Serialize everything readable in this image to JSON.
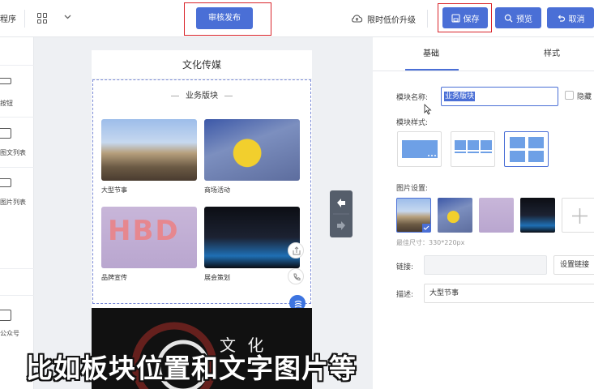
{
  "topbar": {
    "left_text": "程序",
    "publish_label": "审核发布",
    "upgrade_label": "限时低价升级",
    "save_label": "保存",
    "preview_label": "预览",
    "cancel_label": "取消"
  },
  "leftbar": {
    "items": [
      {
        "label": "按钮",
        "icon": "button-icon"
      },
      {
        "label": "图文列表",
        "icon": "list-icon"
      },
      {
        "label": "图片列表",
        "icon": "image-list-icon"
      },
      {
        "label": "公众号",
        "icon": "account-icon"
      }
    ]
  },
  "phone": {
    "title": "文化传媒",
    "module_title": "业务版块",
    "tiles": [
      {
        "caption": "大型节事"
      },
      {
        "caption": "商场活动"
      },
      {
        "caption": "品牌宣传",
        "photo_text": "HBD"
      },
      {
        "caption": "展会策划"
      }
    ],
    "banner_text": "文 化"
  },
  "panel": {
    "tabs": [
      "基础",
      "样式"
    ],
    "module_name_label": "模块名称:",
    "module_name_value": "业务版块",
    "hide_label": "隐藏",
    "module_style_label": "模块样式:",
    "image_settings_label": "图片设置:",
    "best_size": "最佳尺寸：330*220px",
    "link_label": "链接:",
    "link_button": "设置链接",
    "desc_label": "描述:",
    "desc_value": "大型节事"
  },
  "subtitle": "比如板块位置和文字图片等",
  "colors": {
    "accent": "#4a6fd6",
    "highlight_border": "#d9252b"
  }
}
